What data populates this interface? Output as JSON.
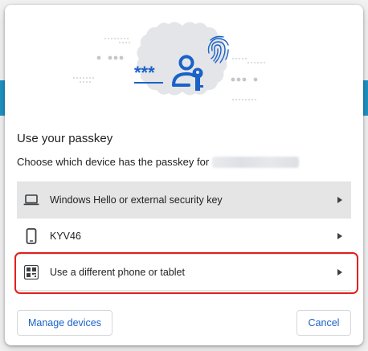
{
  "dialog": {
    "title": "Use your passkey",
    "subtitle": "Choose which device has the passkey for",
    "illustration": {
      "password_mask": "***",
      "icons": [
        "person-key-icon",
        "fingerprint-icon"
      ]
    },
    "devices": [
      {
        "label": "Windows Hello or external security key",
        "icon": "laptop-icon",
        "selected": true
      },
      {
        "label": "KYV46",
        "icon": "phone-icon",
        "selected": false
      },
      {
        "label": "Use a different phone or tablet",
        "icon": "qr-code-icon",
        "selected": false
      }
    ],
    "buttons": {
      "manage": "Manage devices",
      "cancel": "Cancel"
    }
  },
  "colors": {
    "accent": "#1a62c8",
    "highlight_outline": "#e0201a",
    "selected_row": "#e5e5e5"
  }
}
